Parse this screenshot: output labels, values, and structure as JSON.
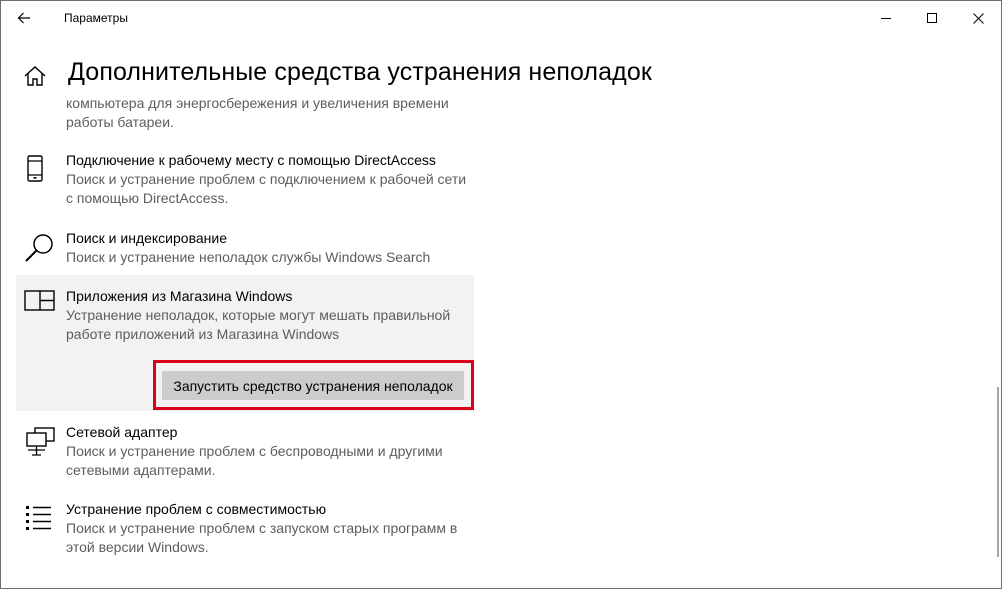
{
  "window": {
    "title": "Параметры",
    "controls": [
      "minimize-icon",
      "maximize-icon",
      "close-icon"
    ]
  },
  "header": {
    "title": "Дополнительные средства устранения неполадок"
  },
  "fragment_text": "компьютера для энергосбережения и увеличения  времени работы батареи.",
  "items": [
    {
      "icon": "phone-icon",
      "title": "Подключение к рабочему месту с помощью DirectAccess",
      "description": "Поиск и устранение проблем с подключением к рабочей сети с помощью DirectAccess."
    },
    {
      "icon": "search-icon",
      "title": "Поиск и индексирование",
      "description": "Поиск и устранение неполадок службы Windows Search"
    },
    {
      "icon": "store-apps-icon",
      "title": "Приложения из Магазина Windows",
      "description": "Устранение неполадок, которые могут мешать правильной работе приложений из Магазина Windows",
      "button": "Запустить средство устранения неполадок",
      "selected": true
    },
    {
      "icon": "network-adapter-icon",
      "title": "Сетевой адаптер",
      "description": "Поиск и устранение проблем с беспроводными и другими сетевыми адаптерами."
    },
    {
      "icon": "compatibility-list-icon",
      "title": "Устранение проблем с совместимостью",
      "description": "Поиск и устранение проблем с запуском старых программ в этой версии Windows."
    }
  ],
  "colors": {
    "highlight_border": "#d9001b",
    "selected_background": "#f2f2f2",
    "button_background": "#cccccc",
    "description_text": "#5d5d5d"
  }
}
